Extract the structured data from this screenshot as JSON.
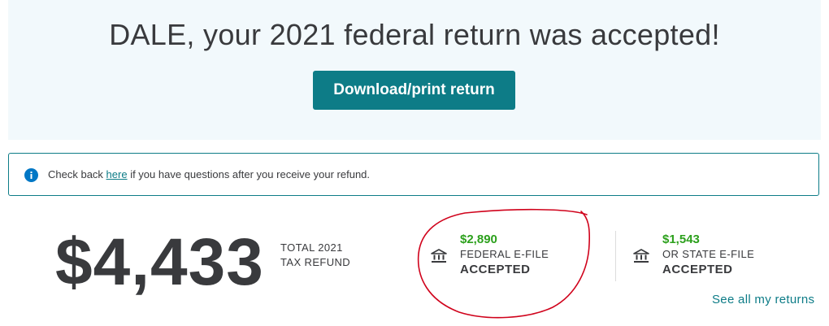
{
  "hero": {
    "title": "DALE, your 2021 federal return was accepted!",
    "download_label": "Download/print return"
  },
  "info": {
    "icon": "info-icon",
    "text_before": "Check back ",
    "link_text": "here",
    "text_after": " if you have questions after you receive your refund."
  },
  "refund": {
    "amount": "$4,433",
    "label_line1": "TOTAL 2021",
    "label_line2": "TAX REFUND"
  },
  "federal": {
    "icon": "bank-icon",
    "amount": "$2,890",
    "label": "FEDERAL E-FILE",
    "status": "ACCEPTED"
  },
  "state": {
    "icon": "bank-icon",
    "amount": "$1,543",
    "label": "OR STATE E-FILE",
    "status": "ACCEPTED"
  },
  "links": {
    "see_all": "See all my returns"
  },
  "colors": {
    "accent": "#0d7c87",
    "amount_green": "#2ca01c",
    "annotation_red": "#d0021b",
    "hero_bg": "#f2f9fc"
  }
}
